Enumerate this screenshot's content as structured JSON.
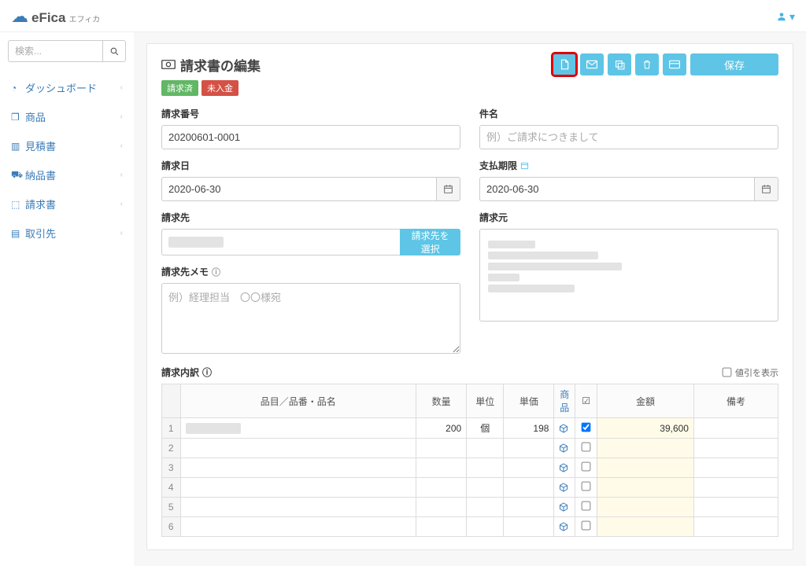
{
  "brand": {
    "name": "eFica",
    "sub": "エフィカ"
  },
  "search": {
    "placeholder": "検索..."
  },
  "sidebar": {
    "items": [
      {
        "label": "ダッシュボード",
        "icon": "dashboard"
      },
      {
        "label": "商品",
        "icon": "box"
      },
      {
        "label": "見積書",
        "icon": "calc"
      },
      {
        "label": "納品書",
        "icon": "truck"
      },
      {
        "label": "請求書",
        "icon": "money"
      },
      {
        "label": "取引先",
        "icon": "card"
      }
    ]
  },
  "page": {
    "title": "請求書の編集",
    "badges": {
      "billed": "請求済",
      "unpaid": "未入金"
    },
    "save": "保存"
  },
  "form": {
    "number_label": "請求番号",
    "number_value": "20200601-0001",
    "subject_label": "件名",
    "subject_placeholder": "例）ご請求につきまして",
    "date_label": "請求日",
    "date_value": "2020-06-30",
    "due_label": "支払期限",
    "due_value": "2020-06-30",
    "billto_label": "請求先",
    "billto_btn": "請求先を選択",
    "sender_label": "請求元",
    "memo_label": "請求先メモ",
    "memo_placeholder": "例）経理担当　〇〇様宛"
  },
  "lines": {
    "title": "請求内訳",
    "discount_label": "値引を表示",
    "headers": {
      "item": "品目／品番・品名",
      "qty": "数量",
      "unit": "単位",
      "price": "単価",
      "product": "商品",
      "amount": "金額",
      "note": "備考"
    },
    "rows": [
      {
        "n": "1",
        "item": "",
        "qty": "200",
        "unit": "個",
        "price": "198",
        "checked": true,
        "amount": "39,600"
      },
      {
        "n": "2",
        "checked": false
      },
      {
        "n": "3",
        "checked": false
      },
      {
        "n": "4",
        "checked": false
      },
      {
        "n": "5",
        "checked": false
      },
      {
        "n": "6",
        "checked": false
      }
    ]
  }
}
